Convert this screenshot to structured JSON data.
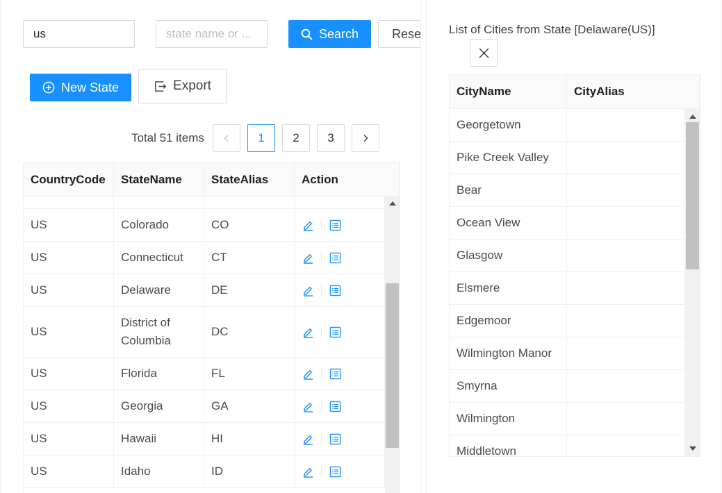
{
  "search": {
    "code_value": "us",
    "name_placeholder": "state name or ...",
    "search_label": "Search",
    "reset_label": "Reset"
  },
  "toolbar": {
    "new_label": "New State",
    "export_label": "Export"
  },
  "pagination": {
    "total_text": "Total 51 items",
    "pages": [
      "1",
      "2",
      "3"
    ],
    "current_page": "1"
  },
  "states_table": {
    "headers": [
      "CountryCode",
      "StateName",
      "StateAlias",
      "Action"
    ],
    "rows": [
      {
        "code": "US",
        "name": "Colorado",
        "alias": "CO"
      },
      {
        "code": "US",
        "name": "Connecticut",
        "alias": "CT"
      },
      {
        "code": "US",
        "name": "Delaware",
        "alias": "DE"
      },
      {
        "code": "US",
        "name": "District of Columbia",
        "alias": "DC"
      },
      {
        "code": "US",
        "name": "Florida",
        "alias": "FL"
      },
      {
        "code": "US",
        "name": "Georgia",
        "alias": "GA"
      },
      {
        "code": "US",
        "name": "Hawaii",
        "alias": "HI"
      },
      {
        "code": "US",
        "name": "Idaho",
        "alias": "ID"
      }
    ],
    "row_icons": [
      "edit-icon",
      "detail-list-icon"
    ]
  },
  "cities_panel": {
    "title": "List of Cities from State [Delaware(US)]",
    "close_label": "X",
    "headers": [
      "CityName",
      "CityAlias"
    ],
    "rows": [
      {
        "name": "Georgetown",
        "alias": ""
      },
      {
        "name": "Pike Creek Valley",
        "alias": ""
      },
      {
        "name": "Bear",
        "alias": ""
      },
      {
        "name": "Ocean View",
        "alias": ""
      },
      {
        "name": "Glasgow",
        "alias": ""
      },
      {
        "name": "Elsmere",
        "alias": ""
      },
      {
        "name": "Edgemoor",
        "alias": ""
      },
      {
        "name": "Wilmington Manor",
        "alias": ""
      },
      {
        "name": "Smyrna",
        "alias": ""
      },
      {
        "name": "Wilmington",
        "alias": ""
      },
      {
        "name": "Middletown",
        "alias": ""
      }
    ]
  },
  "colors": {
    "primary": "#1890ff",
    "border": "#d9d9d9",
    "header_bg": "#fafafa",
    "scroll_thumb": "#c1c1c1"
  }
}
